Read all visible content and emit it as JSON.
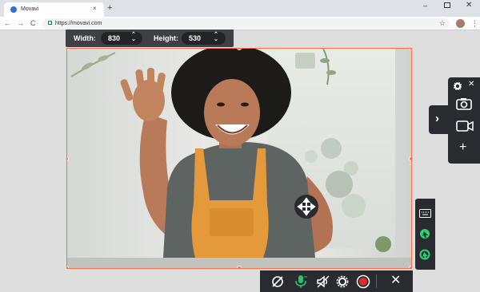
{
  "browser": {
    "tab_title": "Movavi",
    "tab_close": "×",
    "new_tab": "+",
    "url": "https://movavi.com",
    "nav": {
      "back": "←",
      "forward": "→",
      "reload": "C"
    },
    "bookmark_star": "☆",
    "menu": "⋮",
    "window": {
      "minimize": "–",
      "close": "✕"
    }
  },
  "size_panel": {
    "width_label": "Width:",
    "width_value": "830",
    "height_label": "Height:",
    "height_value": "530",
    "stepper_up": "⌃",
    "stepper_down": "⌄"
  },
  "right_panel": {
    "expand": "›",
    "close": "✕",
    "add": "+"
  },
  "bottom_bar": {
    "close": "✕"
  },
  "colors": {
    "accent": "#ff6e4a",
    "panel": "#2a2b30",
    "size_panel": "#3e4045",
    "record": "#e52b2b",
    "mic_on": "#27c46b",
    "cursor_effect": "#2fd177"
  },
  "icons": {
    "settings": "gear-icon",
    "screenshot": "camera-icon",
    "record_video": "video-camera-icon",
    "move": "move-arrows-icon",
    "webcam_off": "webcam-off-icon",
    "microphone": "microphone-icon",
    "system_audio_off": "speaker-off-icon",
    "record": "record-icon",
    "keystrokes": "keyboard-icon",
    "mouse_click": "mouse-click-icon",
    "cursor_highlight": "cursor-highlight-icon"
  }
}
